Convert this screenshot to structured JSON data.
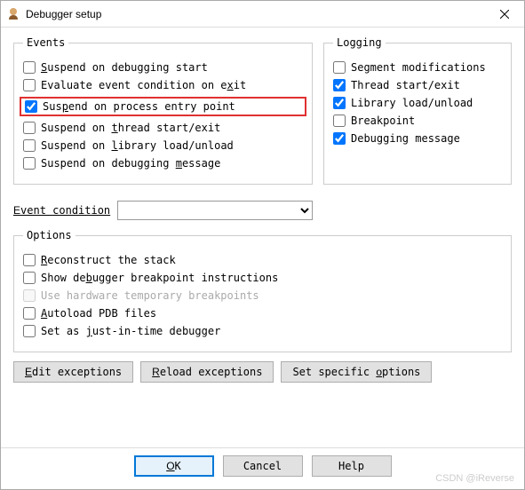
{
  "window": {
    "title": "Debugger setup",
    "icon": "app-icon"
  },
  "events": {
    "legend": "Events",
    "items": [
      {
        "label": "Suspend on debugging start",
        "checked": false,
        "key": "S"
      },
      {
        "label": "Evaluate event condition on exit",
        "checked": false,
        "key": "x"
      },
      {
        "label": "Suspend on process entry point",
        "checked": true,
        "key": "p",
        "highlighted": true
      },
      {
        "label": "Suspend on thread start/exit",
        "checked": false,
        "key": "t"
      },
      {
        "label": "Suspend on library load/unload",
        "checked": false,
        "key": "l"
      },
      {
        "label": "Suspend on debugging message",
        "checked": false,
        "key": "m"
      }
    ]
  },
  "logging": {
    "legend": "Logging",
    "items": [
      {
        "label": "Segment modifications",
        "checked": false
      },
      {
        "label": "Thread start/exit",
        "checked": true
      },
      {
        "label": "Library load/unload",
        "checked": true
      },
      {
        "label": "Breakpoint",
        "checked": false
      },
      {
        "label": "Debugging message",
        "checked": true
      }
    ]
  },
  "event_condition": {
    "label": "Event condition",
    "value": ""
  },
  "options": {
    "legend": "Options",
    "items": [
      {
        "label": "Reconstruct the stack",
        "checked": false,
        "key": "R"
      },
      {
        "label": "Show debugger breakpoint instructions",
        "checked": false,
        "key": "b"
      },
      {
        "label": "Use hardware temporary breakpoints",
        "checked": false,
        "disabled": true
      },
      {
        "label": "Autoload PDB files",
        "checked": false,
        "key": "A"
      },
      {
        "label": "Set as just-in-time debugger",
        "checked": false,
        "key": "j"
      }
    ]
  },
  "buttons": {
    "edit_exceptions": "Edit exceptions",
    "reload_exceptions": "Reload exceptions",
    "set_specific_options": "Set specific options",
    "ok": "OK",
    "cancel": "Cancel",
    "help": "Help"
  },
  "watermark": "CSDN @iReverse"
}
